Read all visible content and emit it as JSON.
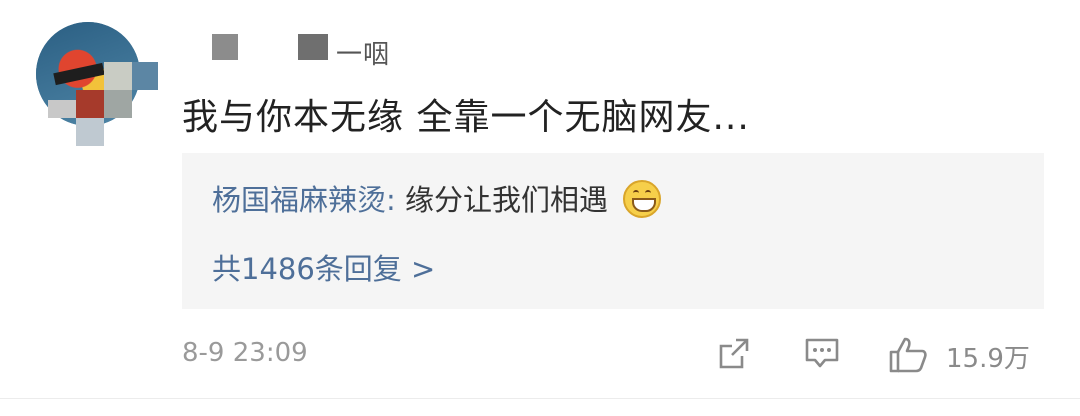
{
  "user": {
    "name_partial": "一咽"
  },
  "comment": {
    "text": "我与你本无缘  全靠一个无脑网友..."
  },
  "reply": {
    "author": "杨国福麻辣烫",
    "separator": ": ",
    "text": "缘分让我们相遇",
    "emoji": "grin-emoji",
    "more_label": "共1486条回复 >"
  },
  "meta": {
    "timestamp": "8-9 23:09",
    "like_count": "15.9万"
  },
  "icons": {
    "share": "share-icon",
    "reply": "comment-icon",
    "like": "thumbs-up-icon"
  },
  "colors": {
    "link": "#4e6f99",
    "text": "#222222",
    "muted": "#9a9a9a",
    "reply_bg": "#f5f5f5"
  }
}
